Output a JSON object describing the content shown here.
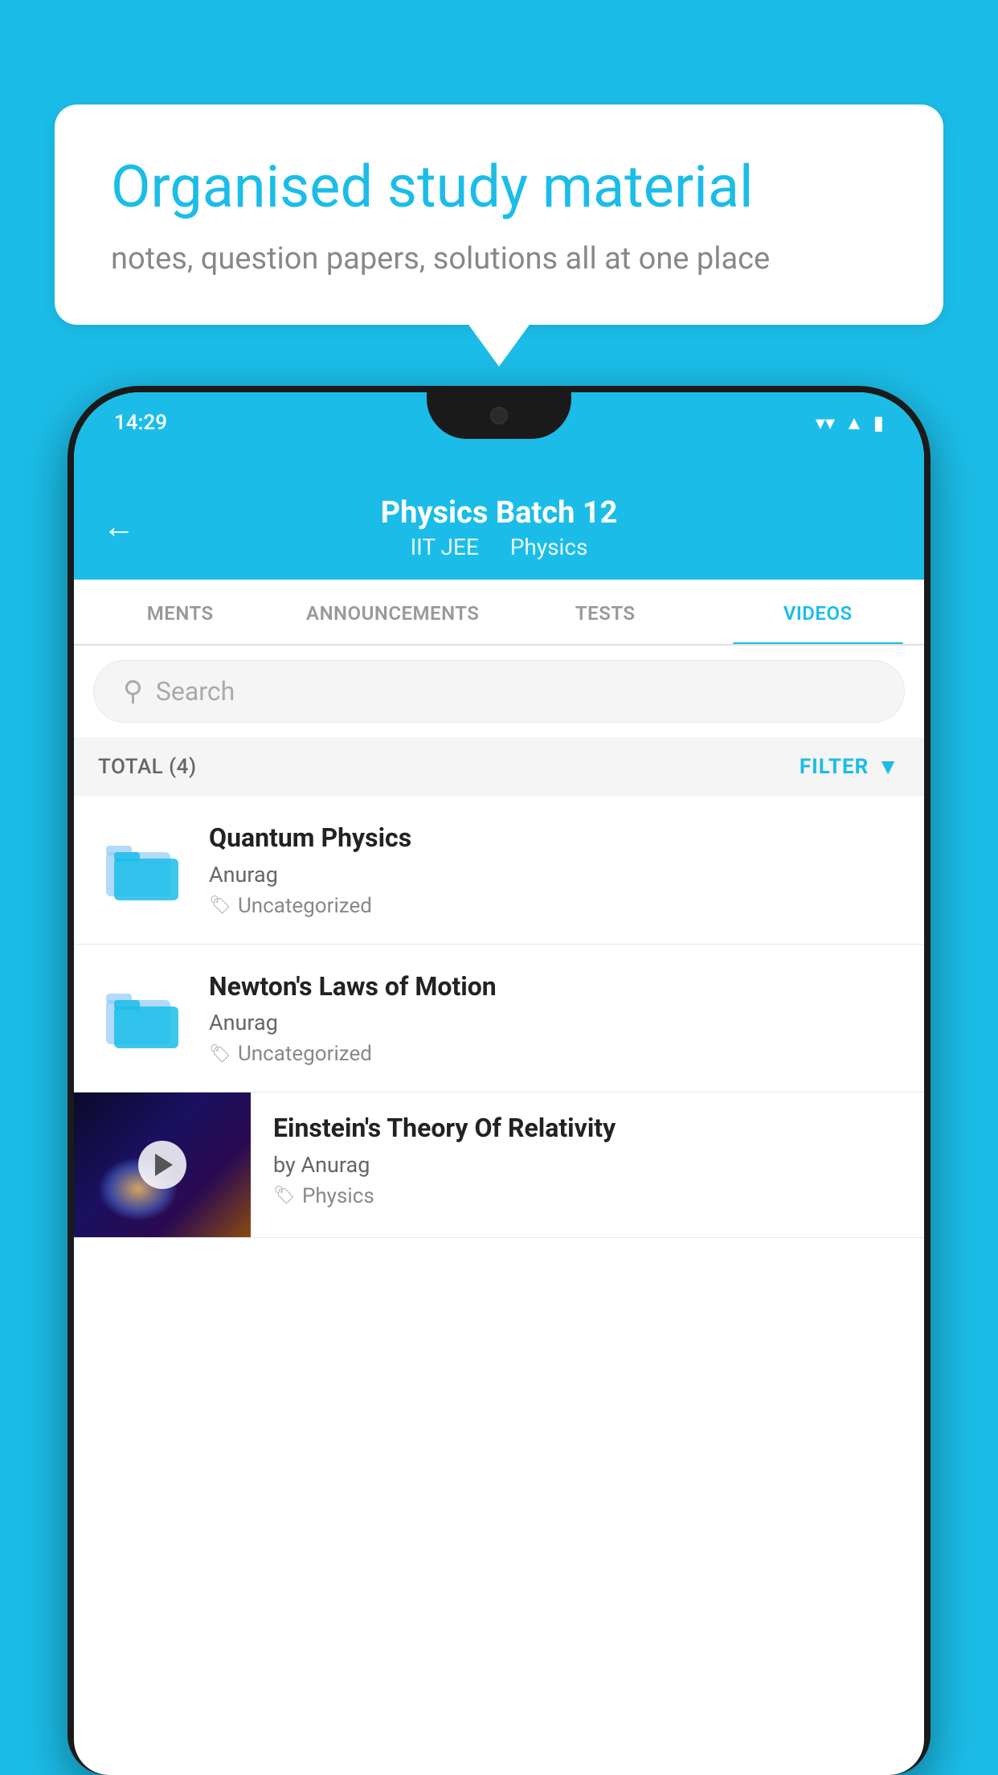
{
  "background_color": "#1BBDE8",
  "speech_bubble": {
    "title": "Organised study material",
    "subtitle": "notes, question papers, solutions all at one place"
  },
  "status_bar": {
    "time": "14:29",
    "icons": [
      "wifi",
      "signal",
      "battery"
    ]
  },
  "header": {
    "back_label": "←",
    "title": "Physics Batch 12",
    "subtitle_part1": "IIT JEE",
    "subtitle_part2": "Physics"
  },
  "tabs": [
    {
      "label": "MENTS",
      "active": false
    },
    {
      "label": "ANNOUNCEMENTS",
      "active": false
    },
    {
      "label": "TESTS",
      "active": false
    },
    {
      "label": "VIDEOS",
      "active": true
    }
  ],
  "search": {
    "placeholder": "Search"
  },
  "filter_row": {
    "total_label": "TOTAL (4)",
    "filter_label": "FILTER"
  },
  "videos": [
    {
      "type": "folder",
      "title": "Quantum Physics",
      "author": "Anurag",
      "tag": "Uncategorized"
    },
    {
      "type": "folder",
      "title": "Newton's Laws of Motion",
      "author": "Anurag",
      "tag": "Uncategorized"
    },
    {
      "type": "thumbnail",
      "title": "Einstein's Theory Of Relativity",
      "author_prefix": "by Anurag",
      "tag": "Physics"
    }
  ]
}
